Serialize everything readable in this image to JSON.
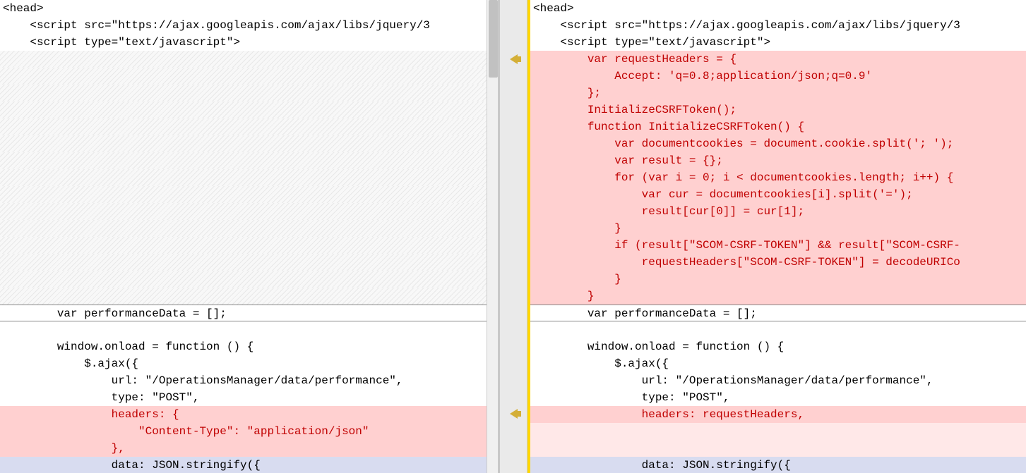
{
  "left": {
    "lines": [
      {
        "cls": "context",
        "text": "<head>"
      },
      {
        "cls": "context",
        "text": "    <script src=\"https://ajax.googleapis.com/ajax/libs/jquery/3"
      },
      {
        "cls": "context",
        "text": "    <script type=\"text/javascript\">"
      },
      {
        "cls": "hatched",
        "text": " "
      },
      {
        "cls": "hatched",
        "text": " "
      },
      {
        "cls": "hatched",
        "text": " "
      },
      {
        "cls": "hatched",
        "text": " "
      },
      {
        "cls": "hatched",
        "text": " "
      },
      {
        "cls": "hatched",
        "text": " "
      },
      {
        "cls": "hatched",
        "text": " "
      },
      {
        "cls": "hatched",
        "text": " "
      },
      {
        "cls": "hatched",
        "text": " "
      },
      {
        "cls": "hatched",
        "text": " "
      },
      {
        "cls": "hatched",
        "text": " "
      },
      {
        "cls": "hatched",
        "text": " "
      },
      {
        "cls": "hatched",
        "text": " "
      },
      {
        "cls": "hatched",
        "text": " "
      },
      {
        "cls": "hatched",
        "text": " "
      },
      {
        "cls": "context current-line",
        "text": "        var performanceData = [];"
      },
      {
        "cls": "context",
        "text": " "
      },
      {
        "cls": "context",
        "text": "        window.onload = function () {"
      },
      {
        "cls": "context",
        "text": "            $.ajax({"
      },
      {
        "cls": "context",
        "text": "                url: \"/OperationsManager/data/performance\","
      },
      {
        "cls": "context",
        "text": "                type: \"POST\","
      },
      {
        "cls": "removed",
        "text": "                headers: {"
      },
      {
        "cls": "removed",
        "text": "                    \"Content-Type\": \"application/json\""
      },
      {
        "cls": "removed",
        "text": "                },"
      },
      {
        "cls": "modified",
        "text": "                data: JSON.stringify({"
      }
    ]
  },
  "right": {
    "lines": [
      {
        "cls": "context",
        "text": "<head>"
      },
      {
        "cls": "context",
        "text": "    <script src=\"https://ajax.googleapis.com/ajax/libs/jquery/3"
      },
      {
        "cls": "context",
        "text": "    <script type=\"text/javascript\">"
      },
      {
        "cls": "added",
        "text": "        var requestHeaders = {"
      },
      {
        "cls": "added",
        "text": "            Accept: 'q=0.8;application/json;q=0.9'"
      },
      {
        "cls": "added",
        "text": "        };"
      },
      {
        "cls": "added",
        "text": "        InitializeCSRFToken();"
      },
      {
        "cls": "added",
        "text": "        function InitializeCSRFToken() {"
      },
      {
        "cls": "added",
        "text": "            var documentcookies = document.cookie.split('; ');"
      },
      {
        "cls": "added",
        "text": "            var result = {};"
      },
      {
        "cls": "added",
        "text": "            for (var i = 0; i < documentcookies.length; i++) {"
      },
      {
        "cls": "added",
        "text": "                var cur = documentcookies[i].split('=');"
      },
      {
        "cls": "added",
        "text": "                result[cur[0]] = cur[1];"
      },
      {
        "cls": "added",
        "text": "            }"
      },
      {
        "cls": "added",
        "text": "            if (result[\"SCOM-CSRF-TOKEN\"] && result[\"SCOM-CSRF-"
      },
      {
        "cls": "added",
        "text": "                requestHeaders[\"SCOM-CSRF-TOKEN\"] = decodeURICo"
      },
      {
        "cls": "added",
        "text": "            }"
      },
      {
        "cls": "added",
        "text": "        }"
      },
      {
        "cls": "context current-line",
        "text": "        var performanceData = [];"
      },
      {
        "cls": "context",
        "text": " "
      },
      {
        "cls": "context",
        "text": "        window.onload = function () {"
      },
      {
        "cls": "context",
        "text": "            $.ajax({"
      },
      {
        "cls": "context",
        "text": "                url: \"/OperationsManager/data/performance\","
      },
      {
        "cls": "context",
        "text": "                type: \"POST\","
      },
      {
        "cls": "added",
        "text": "                headers: requestHeaders,"
      },
      {
        "cls": "added-light",
        "text": " "
      },
      {
        "cls": "added-light",
        "text": " "
      },
      {
        "cls": "modified",
        "text": "                data: JSON.stringify({"
      }
    ]
  },
  "arrows": [
    3,
    24
  ]
}
